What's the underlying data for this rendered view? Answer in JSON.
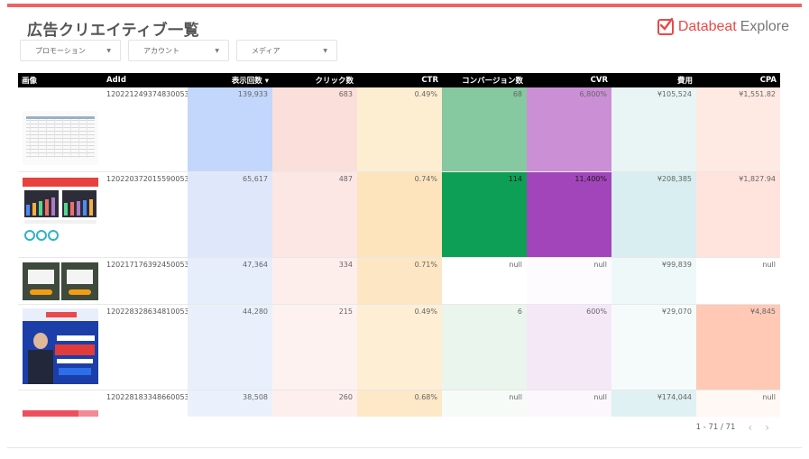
{
  "header": {
    "title": "広告クリエイティブ一覧",
    "logo_brand": "Databeat",
    "logo_suffix": "Explore",
    "accent_color": "#f06262"
  },
  "filters": [
    {
      "label": "プロモーション"
    },
    {
      "label": "アカウント"
    },
    {
      "label": "メディア"
    }
  ],
  "table": {
    "columns": [
      {
        "key": "image",
        "label": "画像"
      },
      {
        "key": "adid",
        "label": "AdId"
      },
      {
        "key": "impressions",
        "label": "表示回数 ▾"
      },
      {
        "key": "clicks",
        "label": "クリック数"
      },
      {
        "key": "ctr",
        "label": "CTR"
      },
      {
        "key": "conversions",
        "label": "コンバージョン数"
      },
      {
        "key": "cvr",
        "label": "CVR"
      },
      {
        "key": "cost",
        "label": "費用"
      },
      {
        "key": "cpa",
        "label": "CPA"
      }
    ],
    "rows": [
      {
        "adid": "120221249374830053",
        "impressions": "139,933",
        "clicks": "683",
        "ctr": "0.49%",
        "conversions": "68",
        "cvr": "6,800%",
        "cost": "¥105,524",
        "cpa": "¥1,551.82",
        "colors": {
          "impressions": "#c3d6fb",
          "clicks": "#fbdfdb",
          "ctr": "#fdeed2",
          "conversions": "#86c8a0",
          "cvr": "#cb8fd6",
          "cost": "#e8f5f4",
          "cpa": "#ffe9e3"
        }
      },
      {
        "adid": "120220372015590053",
        "impressions": "65,617",
        "clicks": "487",
        "ctr": "0.74%",
        "conversions": "114",
        "cvr": "11,400%",
        "cost": "¥208,385",
        "cpa": "¥1,827.94",
        "colors": {
          "impressions": "#dfe8fb",
          "clicks": "#fce7e4",
          "ctr": "#fde4bd",
          "conversions": "#0e9f56",
          "cvr": "#a245bb",
          "cost": "#d8eef0",
          "cpa": "#ffe3dc"
        }
      },
      {
        "adid": "120217176392450053",
        "impressions": "47,364",
        "clicks": "334",
        "ctr": "0.71%",
        "conversions": "null",
        "cvr": "null",
        "cost": "¥99,839",
        "cpa": "null",
        "colors": {
          "impressions": "#e6edfb",
          "clicks": "#fdeeec",
          "ctr": "#fde6c3",
          "conversions": "#ffffff",
          "cvr": "#fdfbfd",
          "cost": "#eef8f8",
          "cpa": "#ffffff"
        }
      },
      {
        "adid": "120228328634810053",
        "impressions": "44,280",
        "clicks": "215",
        "ctr": "0.49%",
        "conversions": "6",
        "cvr": "600%",
        "cost": "¥29,070",
        "cpa": "¥4,845",
        "colors": {
          "impressions": "#e9f0fc",
          "clicks": "#fdf2f0",
          "ctr": "#fdeed4",
          "conversions": "#eaf5ee",
          "cvr": "#f4e8f7",
          "cost": "#f5fbfb",
          "cpa": "#ffc9b6"
        }
      },
      {
        "adid": "120228183348660053",
        "impressions": "38,508",
        "clicks": "260",
        "ctr": "0.68%",
        "conversions": "null",
        "cvr": "null",
        "cost": "¥174,044",
        "cpa": "null",
        "colors": {
          "impressions": "#ebf1fc",
          "clicks": "#fdefed",
          "ctr": "#fde8c8",
          "conversions": "#f6fbf8",
          "cvr": "#fbf7fc",
          "cost": "#dff1f2",
          "cpa": "#fff8f5"
        }
      }
    ]
  },
  "pagination": {
    "range": "1 - 71 / 71",
    "prev": "‹",
    "next": "›"
  }
}
